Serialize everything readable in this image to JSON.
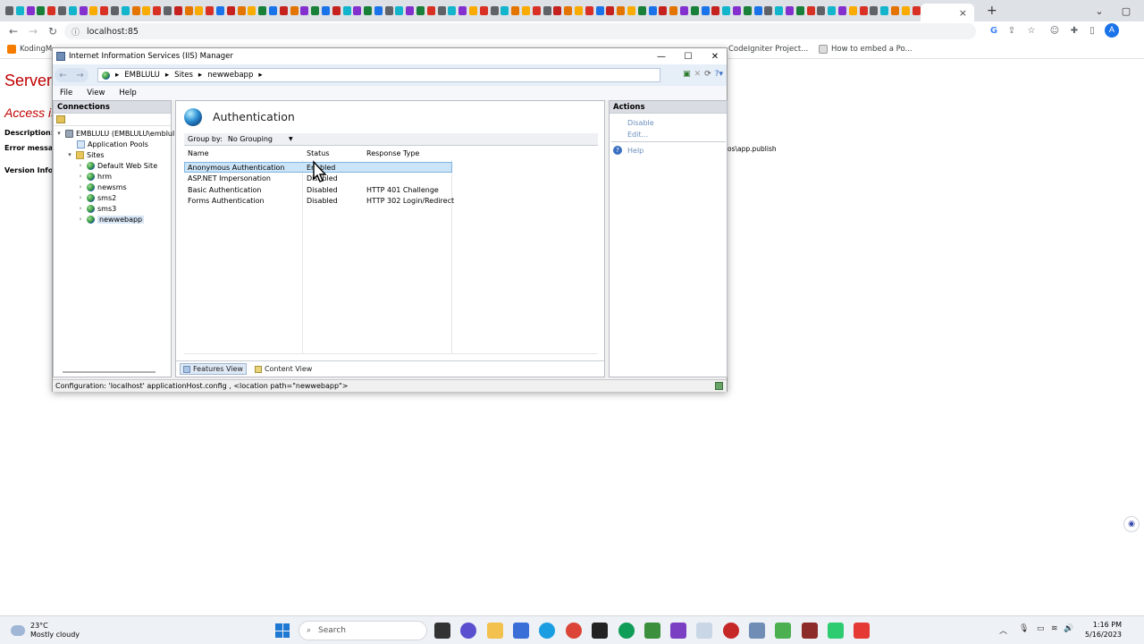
{
  "browser": {
    "address": "localhost:85",
    "bookmarks": [
      "KodingM",
      "CodeIgniter Project...",
      "How to embed a Po..."
    ],
    "tab_close": "×",
    "new_tab": "+",
    "icons": {
      "back": "arrow-left-icon",
      "forward": "arrow-right-icon",
      "reload": "reload-icon",
      "info": "info-icon",
      "minimize": "minimize-icon",
      "restore": "restore-icon",
      "close": "close-icon",
      "profile": "A"
    }
  },
  "background_page": {
    "heading": "Server",
    "subheading": "Access is",
    "labels": [
      "Description:",
      "Error messa",
      "Version Info"
    ],
    "path_fragment": "os\\app.publish"
  },
  "iis": {
    "window_title": "Internet Information Services (IIS) Manager",
    "breadcrumb": [
      "EMBLULU",
      "Sites",
      "newwebapp"
    ],
    "menu": [
      "File",
      "View",
      "Help"
    ],
    "connections": {
      "header": "Connections",
      "server": "EMBLULU (EMBLULU\\emblul",
      "app_pools": "Application Pools",
      "sites_label": "Sites",
      "sites": [
        "Default Web Site",
        "hrm",
        "newsms",
        "sms2",
        "sms3",
        "newwebapp"
      ]
    },
    "feature": {
      "title": "Authentication",
      "group_by_label": "Group by:",
      "group_by_value": "No Grouping",
      "columns": [
        "Name",
        "Status",
        "Response Type"
      ],
      "rows": [
        {
          "name": "Anonymous Authentication",
          "status": "Enabled",
          "response": ""
        },
        {
          "name": "ASP.NET Impersonation",
          "status": "Disabled",
          "response": ""
        },
        {
          "name": "Basic Authentication",
          "status": "Disabled",
          "response": "HTTP 401 Challenge"
        },
        {
          "name": "Forms Authentication",
          "status": "Disabled",
          "response": "HTTP 302 Login/Redirect"
        }
      ],
      "selected_row": 0,
      "views": [
        "Features View",
        "Content View"
      ]
    },
    "actions": {
      "header": "Actions",
      "items": [
        "Disable",
        "Edit..."
      ],
      "help": "Help"
    },
    "status_bar": "Configuration: 'localhost' applicationHost.config , <location path=\"newwebapp\">"
  },
  "taskbar": {
    "temperature": "23°C",
    "weather": "Mostly cloudy",
    "search_placeholder": "Search",
    "time": "1:16 PM",
    "date": "5/16/2023"
  },
  "colors": {
    "error_red": "#c00000",
    "iis_panel_header": "#d9dde3",
    "selection": "#cce4f7",
    "action_link": "#6b8fbf"
  }
}
